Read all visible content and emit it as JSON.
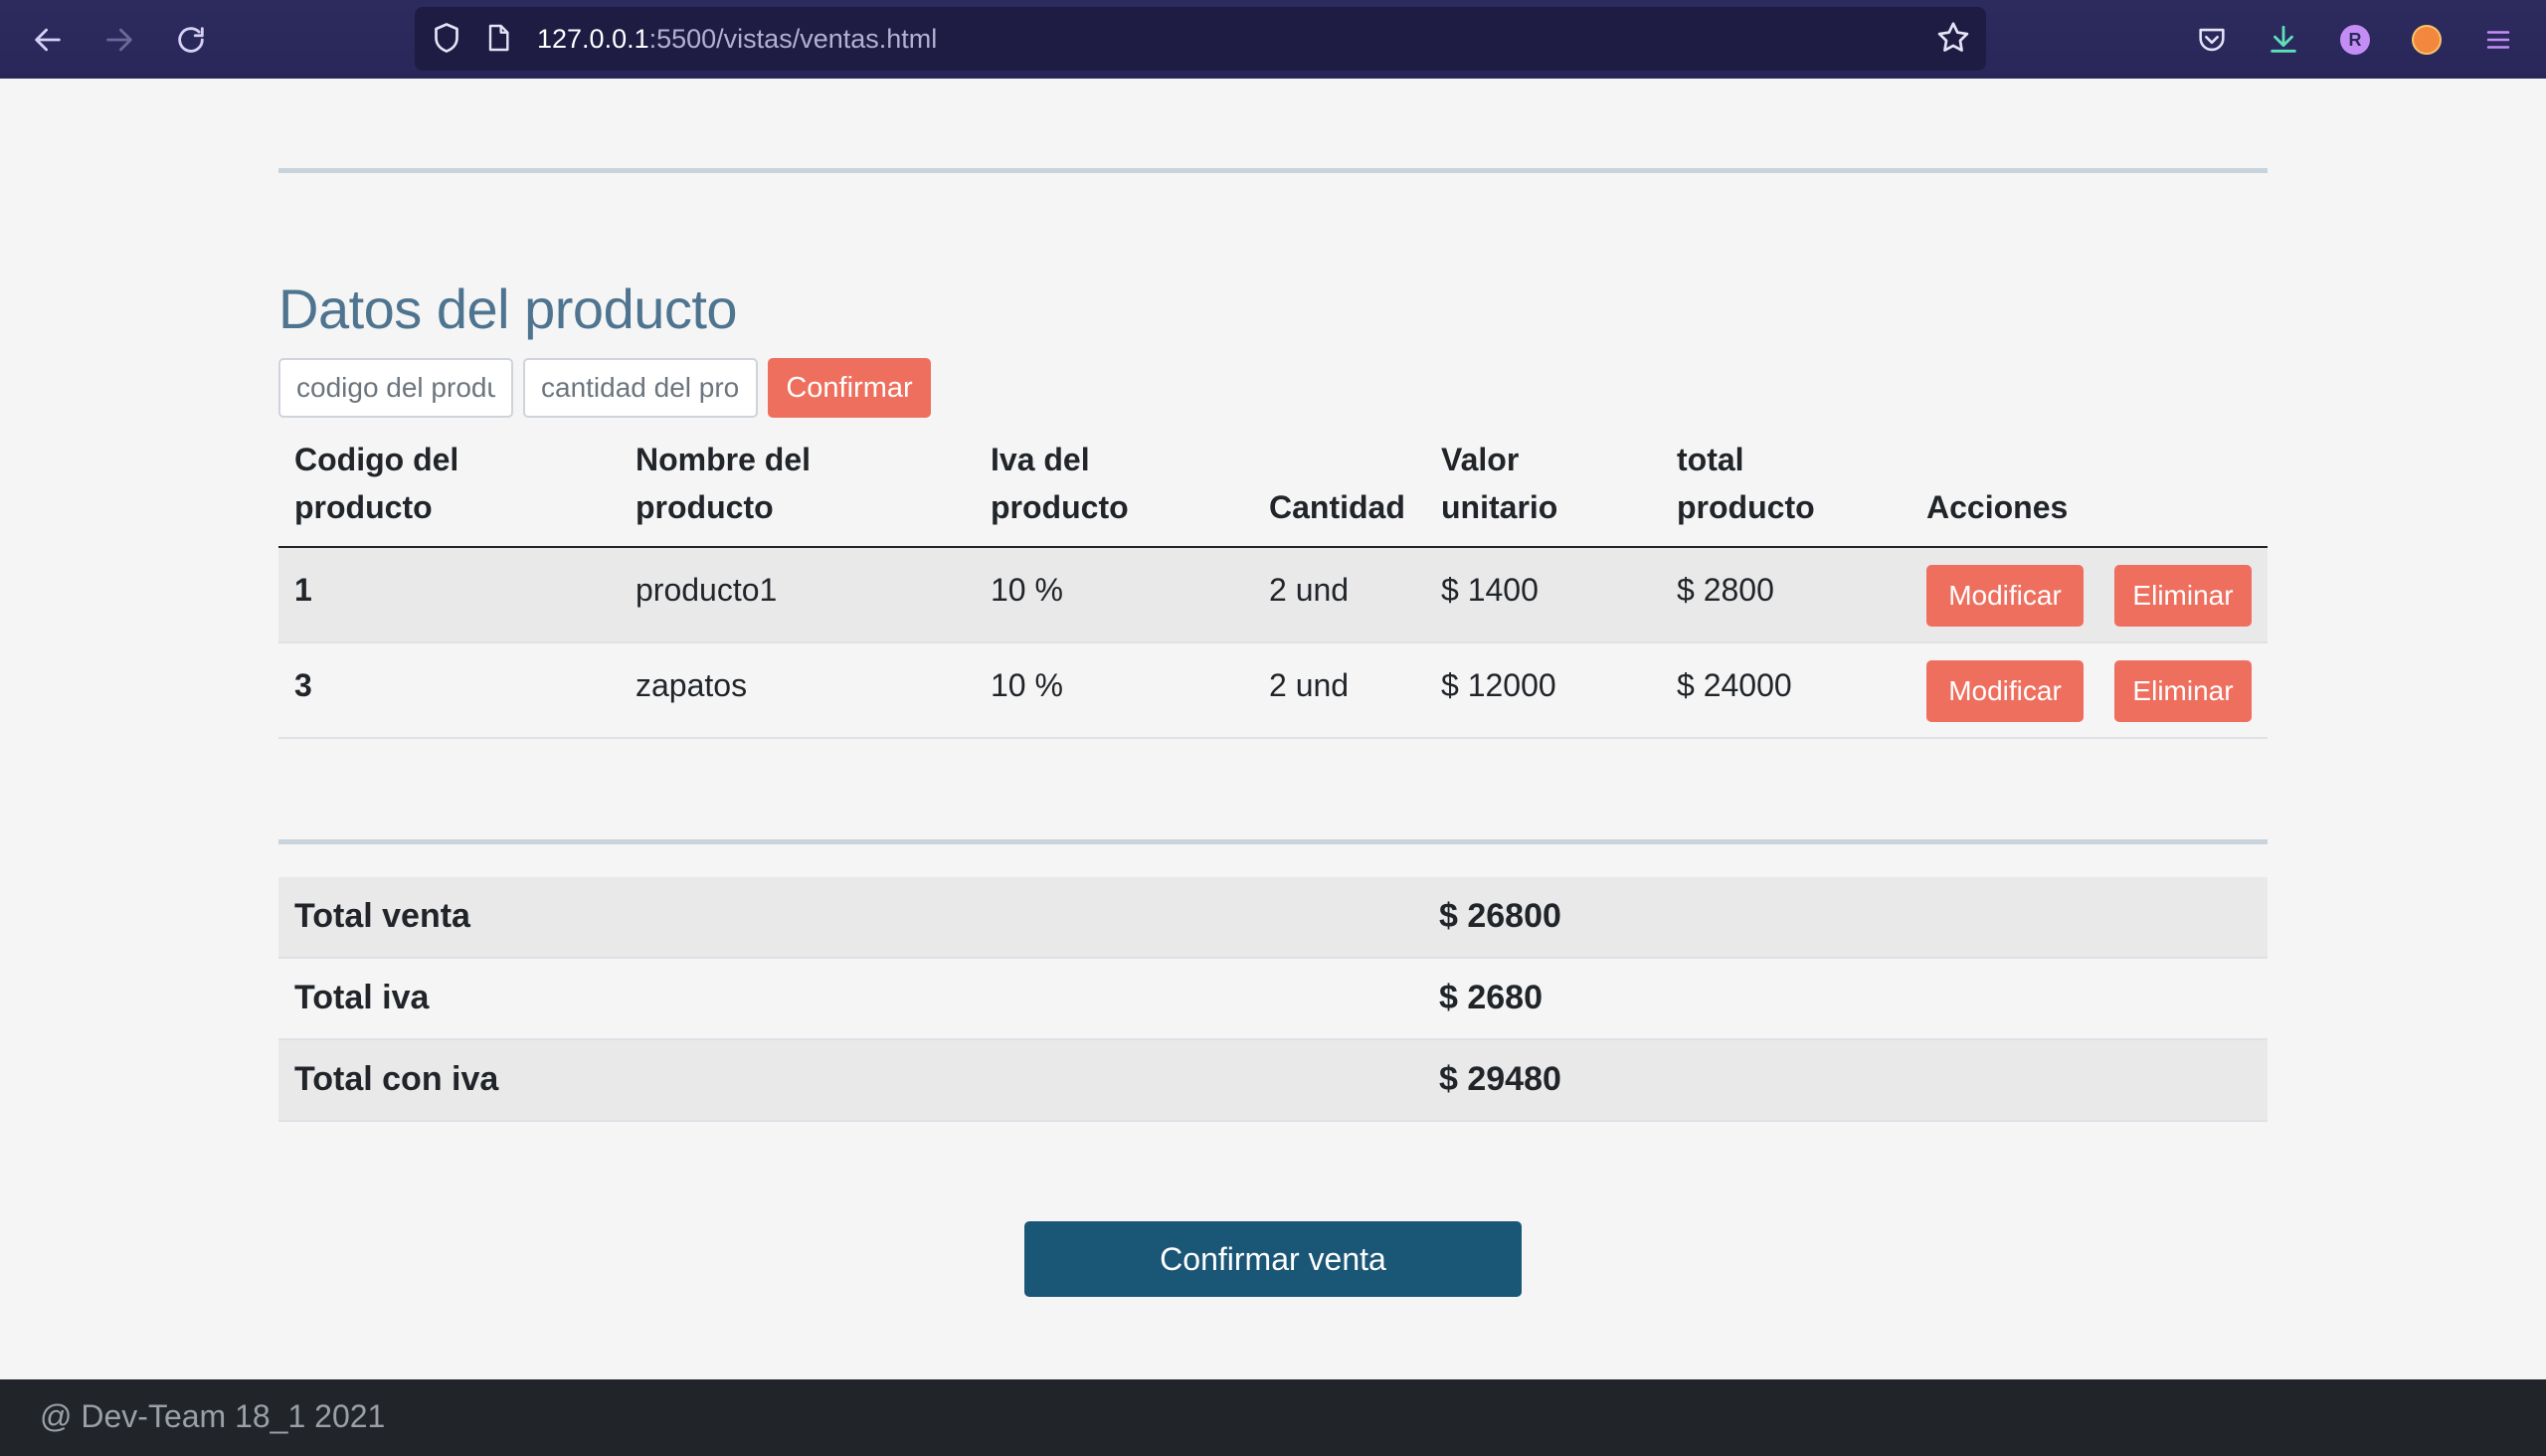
{
  "browser": {
    "url_host": "127.0.0.1",
    "url_path": ":5500/vistas/ventas.html",
    "profile_initial": "R",
    "icons": [
      "back-icon",
      "forward-icon",
      "reload-icon",
      "shield-icon",
      "page-icon",
      "star-icon",
      "pocket-icon",
      "download-icon",
      "profile-icon",
      "extension-icon",
      "menu-icon"
    ]
  },
  "product_section": {
    "title": "Datos del producto",
    "code_placeholder": "codigo del producto",
    "quantity_placeholder": "cantidad del producto",
    "confirm_label": "Confirmar"
  },
  "table": {
    "headers": [
      [
        "Codigo del",
        "producto"
      ],
      [
        "Nombre del",
        "producto"
      ],
      [
        "Iva del",
        "producto"
      ],
      [
        "",
        "Cantidad"
      ],
      [
        "Valor",
        "unitario"
      ],
      [
        "total",
        "producto"
      ],
      [
        "",
        "Acciones"
      ]
    ],
    "rows": [
      {
        "code": "1",
        "name": "producto1",
        "iva": "10 %",
        "qty": "2 und",
        "unit": "$ 1400",
        "total": "$ 2800",
        "modify": "Modificar",
        "delete": "Eliminar"
      },
      {
        "code": "3",
        "name": "zapatos",
        "iva": "10 %",
        "qty": "2 und",
        "unit": "$ 12000",
        "total": "$ 24000",
        "modify": "Modificar",
        "delete": "Eliminar"
      }
    ]
  },
  "totals": [
    {
      "label": "Total venta",
      "value": "$ 26800"
    },
    {
      "label": "Total iva",
      "value": "$ 2680"
    },
    {
      "label": "Total con iva",
      "value": "$ 29480"
    }
  ],
  "confirm_sale_label": "Confirmar venta",
  "footer": "@ Dev-Team 18_1 2021",
  "colors": {
    "toolbar": "#2b2a5a",
    "accent_red": "#ef6f5f",
    "primary": "#1a5676",
    "title": "#4e7490",
    "footer": "#212529"
  }
}
